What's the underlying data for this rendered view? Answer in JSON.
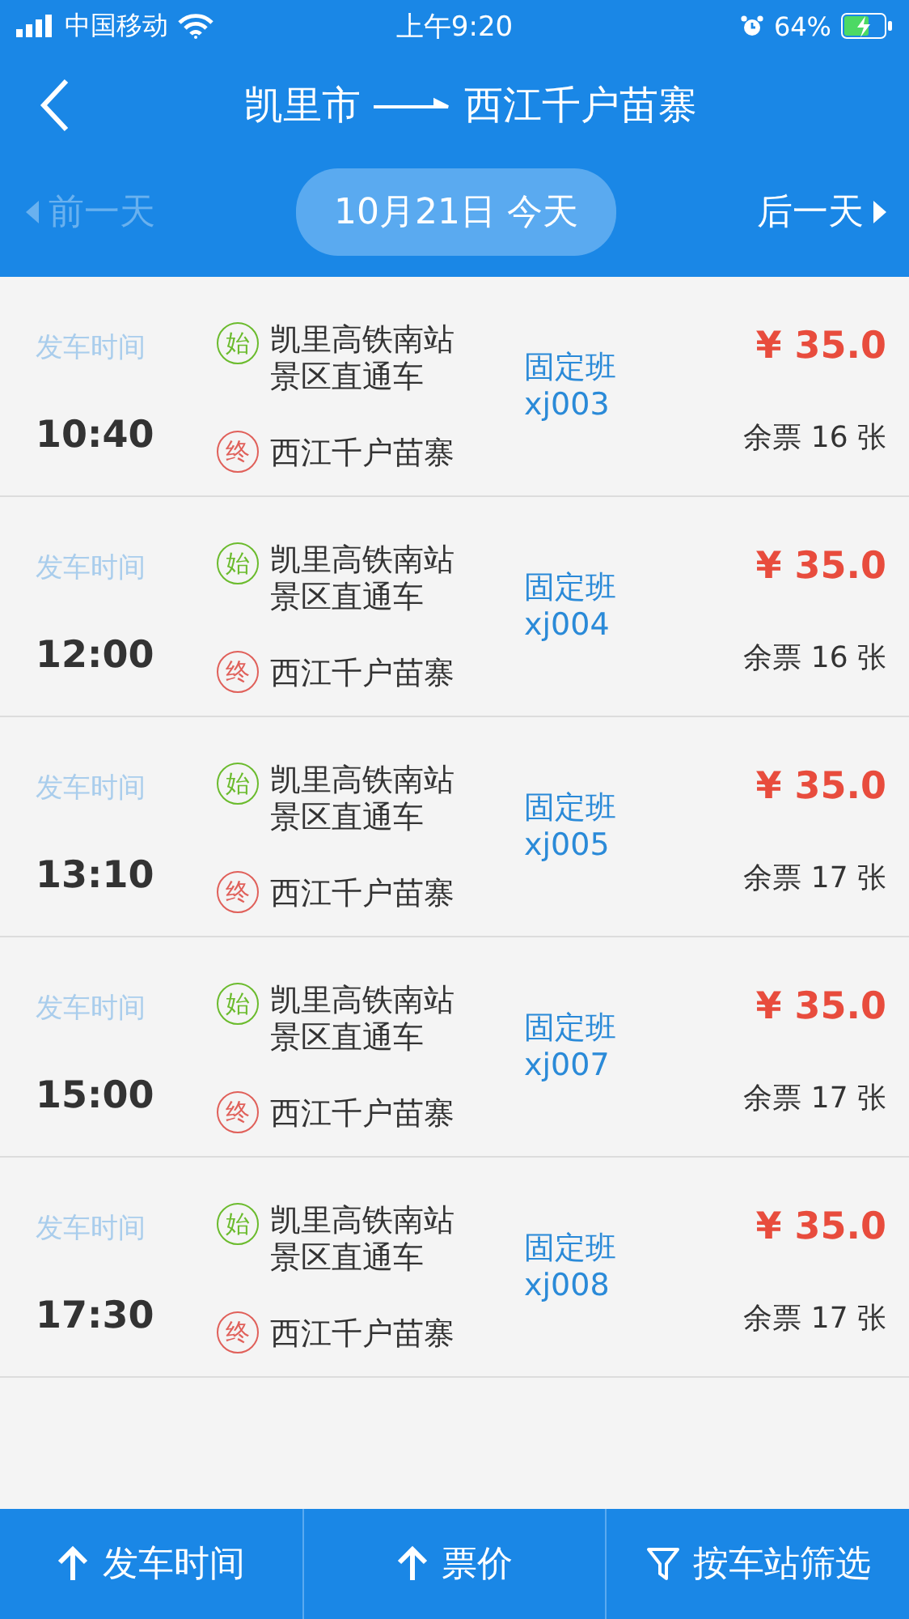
{
  "status_bar": {
    "carrier": "中国移动",
    "time": "上午9:20",
    "battery": "64%"
  },
  "header": {
    "from": "凯里市",
    "to": "西江千户苗寨"
  },
  "date_nav": {
    "prev": {
      "label": "前一天",
      "disabled": true
    },
    "date": "10月21日 今天",
    "next": {
      "label": "后一天",
      "disabled": false
    }
  },
  "trips": [
    {
      "time_label": "发车时间",
      "time": "10:40",
      "start_mark": "始",
      "start": "凯里高铁南站景区直通车",
      "end_mark": "终",
      "end": "西江千户苗寨",
      "type": "固定班",
      "code": "xj003",
      "price": "¥ 35.0",
      "remaining": "余票 16 张"
    },
    {
      "time_label": "发车时间",
      "time": "12:00",
      "start_mark": "始",
      "start": "凯里高铁南站景区直通车",
      "end_mark": "终",
      "end": "西江千户苗寨",
      "type": "固定班",
      "code": "xj004",
      "price": "¥ 35.0",
      "remaining": "余票 16 张"
    },
    {
      "time_label": "发车时间",
      "time": "13:10",
      "start_mark": "始",
      "start": "凯里高铁南站景区直通车",
      "end_mark": "终",
      "end": "西江千户苗寨",
      "type": "固定班",
      "code": "xj005",
      "price": "¥ 35.0",
      "remaining": "余票 17 张"
    },
    {
      "time_label": "发车时间",
      "time": "15:00",
      "start_mark": "始",
      "start": "凯里高铁南站景区直通车",
      "end_mark": "终",
      "end": "西江千户苗寨",
      "type": "固定班",
      "code": "xj007",
      "price": "¥ 35.0",
      "remaining": "余票 17 张"
    },
    {
      "time_label": "发车时间",
      "time": "17:30",
      "start_mark": "始",
      "start": "凯里高铁南站景区直通车",
      "end_mark": "终",
      "end": "西江千户苗寨",
      "type": "固定班",
      "code": "xj008",
      "price": "¥ 35.0",
      "remaining": "余票 17 张"
    }
  ],
  "bottom_bar": [
    {
      "kind": "sort",
      "label": "发车时间"
    },
    {
      "kind": "sort",
      "label": "票价"
    },
    {
      "kind": "filter",
      "label": "按车站筛选"
    }
  ]
}
